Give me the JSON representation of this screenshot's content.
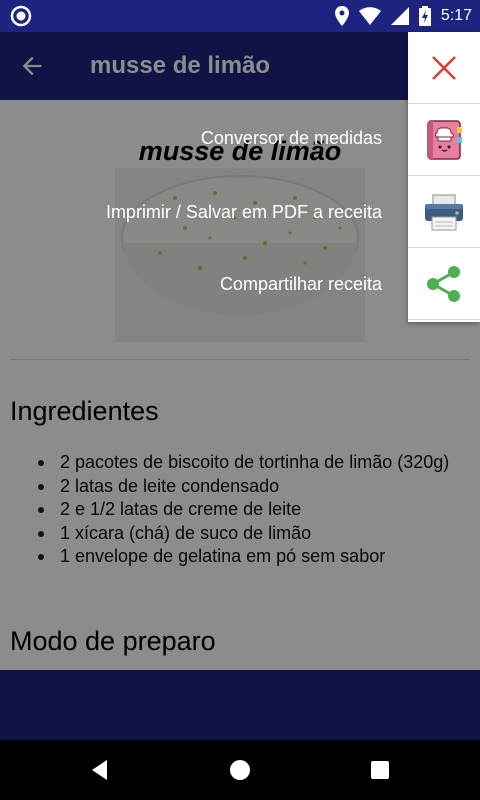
{
  "status_bar": {
    "time": "5:17"
  },
  "app_bar": {
    "title": "musse de limão"
  },
  "recipe": {
    "title": "musse de limão",
    "ingredients_heading": "Ingredientes",
    "ingredients": [
      "2 pacotes de biscoito de tortinha de limão (320g)",
      "2 latas de leite condensado",
      "2 e 1/2 latas de creme de leite",
      "1 xícara (chá) de suco de limão",
      "1 envelope de gelatina em pó sem sabor"
    ],
    "prep_heading": "Modo de preparo"
  },
  "menu": {
    "items": [
      {
        "label": "Conversor de medidas",
        "icon": "recipe-book-icon"
      },
      {
        "label": "Imprimir / Salvar em PDF a receita",
        "icon": "printer-icon"
      },
      {
        "label": "Compartilhar receita",
        "icon": "share-icon"
      }
    ],
    "close_icon": "close-icon"
  },
  "colors": {
    "primary": "#1d2480",
    "close": "#e53935",
    "share": "#4caf50",
    "printer": "#3d5a80",
    "book": "#e97fa0"
  }
}
